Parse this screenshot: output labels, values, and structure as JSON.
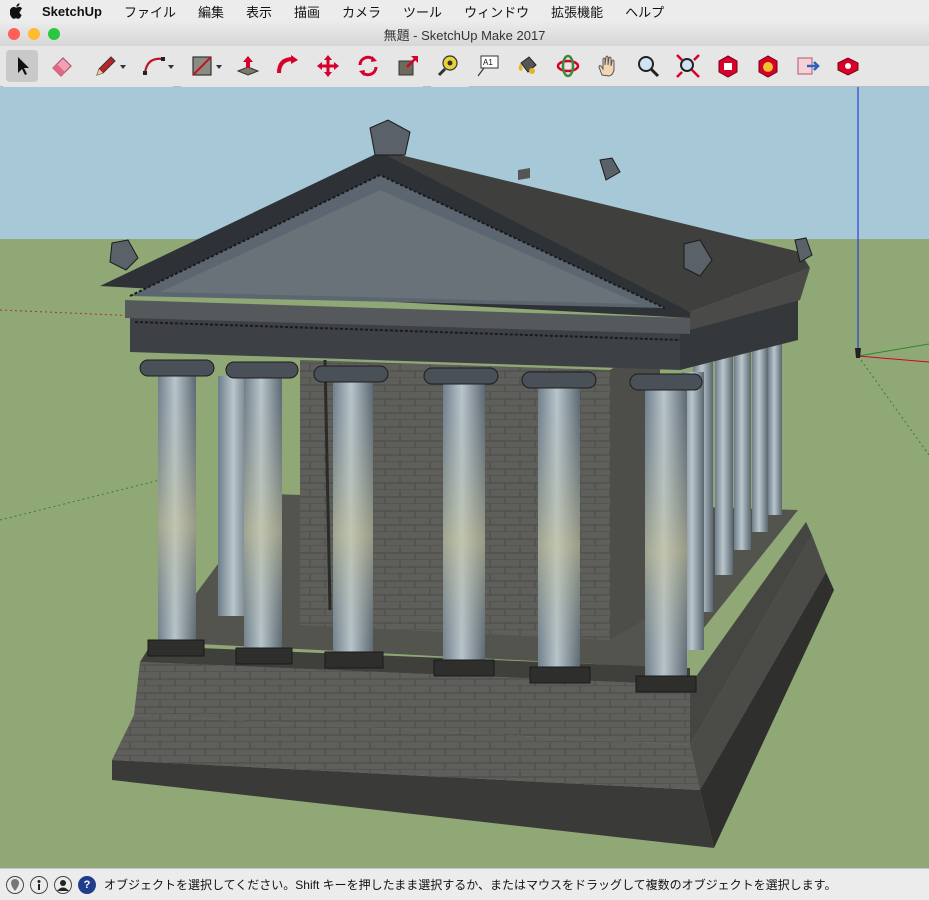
{
  "menubar": {
    "app": "SketchUp",
    "items": [
      "ファイル",
      "編集",
      "表示",
      "描画",
      "カメラ",
      "ツール",
      "ウィンドウ",
      "拡張機能",
      "ヘルプ"
    ]
  },
  "window": {
    "title": "無題 - SketchUp Make 2017"
  },
  "toolbar": {
    "tools": [
      "select-icon",
      "eraser-icon",
      "pencil-icon",
      "arc-icon",
      "shape-icon",
      "push-pull-icon",
      "follow-me-icon",
      "move-icon",
      "rotate-icon",
      "scale-icon",
      "tape-measure-icon",
      "text-icon",
      "paint-bucket-icon",
      "orbit-icon",
      "pan-icon",
      "zoom-icon",
      "zoom-extents-icon",
      "warehouse-icon",
      "extension-warehouse-icon",
      "send-to-layout-icon",
      "extension-manager-icon"
    ]
  },
  "status": {
    "message": "オブジェクトを選択してください。Shift キーを押したまま選択するか、またはマウスをドラッグして複数のオブジェクトを選択します。"
  },
  "colors": {
    "sky": "#a7c8d6",
    "ground": "#8fa876",
    "accent_red": "#d6002a",
    "close": "#ff5f57",
    "minimize": "#febc2e",
    "zoom": "#28c840"
  }
}
